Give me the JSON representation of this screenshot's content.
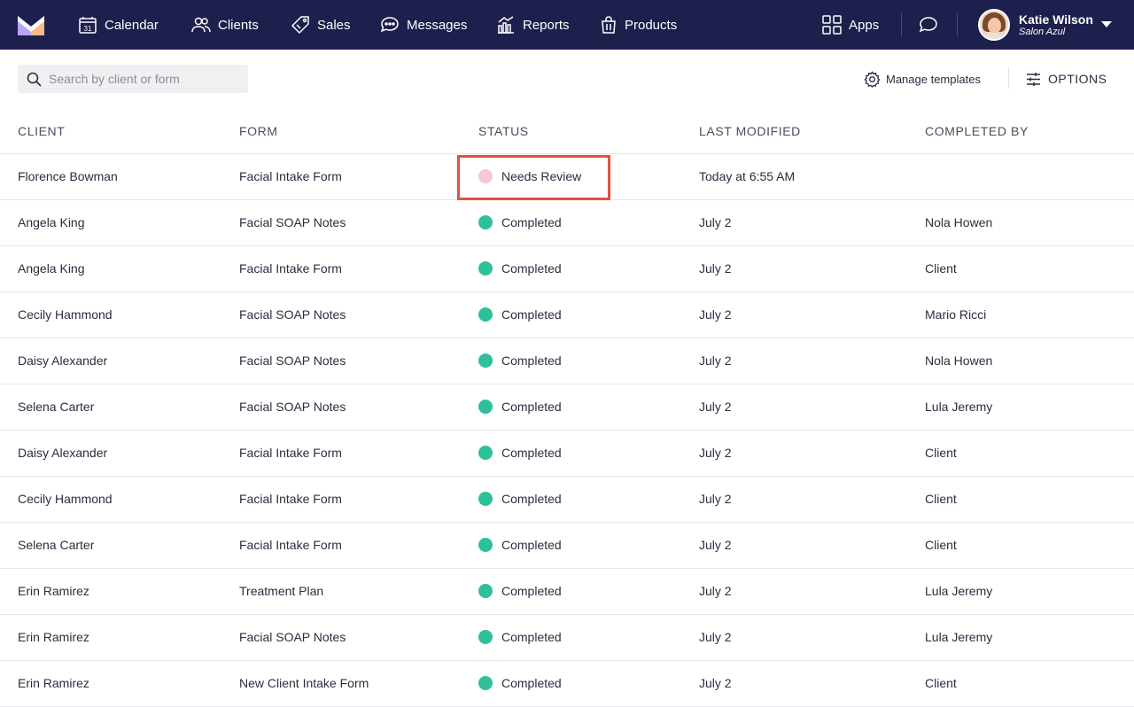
{
  "nav": {
    "items": [
      {
        "label": "Calendar",
        "icon": "calendar-icon"
      },
      {
        "label": "Clients",
        "icon": "clients-icon"
      },
      {
        "label": "Sales",
        "icon": "tag-icon"
      },
      {
        "label": "Messages",
        "icon": "chat-icon"
      },
      {
        "label": "Reports",
        "icon": "chart-icon"
      },
      {
        "label": "Products",
        "icon": "bag-icon"
      }
    ],
    "apps_label": "Apps",
    "calendar_day": "31",
    "user": {
      "name": "Katie Wilson",
      "business": "Salon Azul"
    }
  },
  "toolbar": {
    "search_placeholder": "Search by client or form",
    "manage_label": "Manage templates",
    "options_label": "OPTIONS"
  },
  "table": {
    "headers": [
      "CLIENT",
      "FORM",
      "STATUS",
      "LAST MODIFIED",
      "COMPLETED BY"
    ],
    "rows": [
      {
        "client": "Florence Bowman",
        "form": "Facial Intake Form",
        "status": "Needs Review",
        "modified": "Today at 6:55 AM",
        "completed_by": ""
      },
      {
        "client": "Angela King",
        "form": "Facial SOAP Notes",
        "status": "Completed",
        "modified": "July 2",
        "completed_by": "Nola Howen"
      },
      {
        "client": "Angela King",
        "form": "Facial Intake Form",
        "status": "Completed",
        "modified": "July 2",
        "completed_by": "Client"
      },
      {
        "client": "Cecily Hammond",
        "form": "Facial SOAP Notes",
        "status": "Completed",
        "modified": "July 2",
        "completed_by": "Mario Ricci"
      },
      {
        "client": "Daisy Alexander",
        "form": "Facial SOAP Notes",
        "status": "Completed",
        "modified": "July 2",
        "completed_by": "Nola Howen"
      },
      {
        "client": "Selena Carter",
        "form": "Facial SOAP Notes",
        "status": "Completed",
        "modified": "July 2",
        "completed_by": "Lula Jeremy"
      },
      {
        "client": "Daisy Alexander",
        "form": "Facial Intake Form",
        "status": "Completed",
        "modified": "July 2",
        "completed_by": "Client"
      },
      {
        "client": "Cecily Hammond",
        "form": "Facial Intake Form",
        "status": "Completed",
        "modified": "July 2",
        "completed_by": "Client"
      },
      {
        "client": "Selena Carter",
        "form": "Facial Intake Form",
        "status": "Completed",
        "modified": "July 2",
        "completed_by": "Client"
      },
      {
        "client": "Erin Ramirez",
        "form": "Treatment Plan",
        "status": "Completed",
        "modified": "July 2",
        "completed_by": "Lula Jeremy"
      },
      {
        "client": "Erin Ramirez",
        "form": "Facial SOAP Notes",
        "status": "Completed",
        "modified": "July 2",
        "completed_by": "Lula Jeremy"
      },
      {
        "client": "Erin Ramirez",
        "form": "New Client Intake Form",
        "status": "Completed",
        "modified": "July 2",
        "completed_by": "Client"
      }
    ]
  },
  "colors": {
    "nav_bg": "#1d1f4c",
    "completed": "#2fbf9b",
    "needs_review": "#f6c6dc",
    "highlight": "#e0533f",
    "logo_left": "#a78bfa",
    "logo_right": "#fbbf8a"
  }
}
